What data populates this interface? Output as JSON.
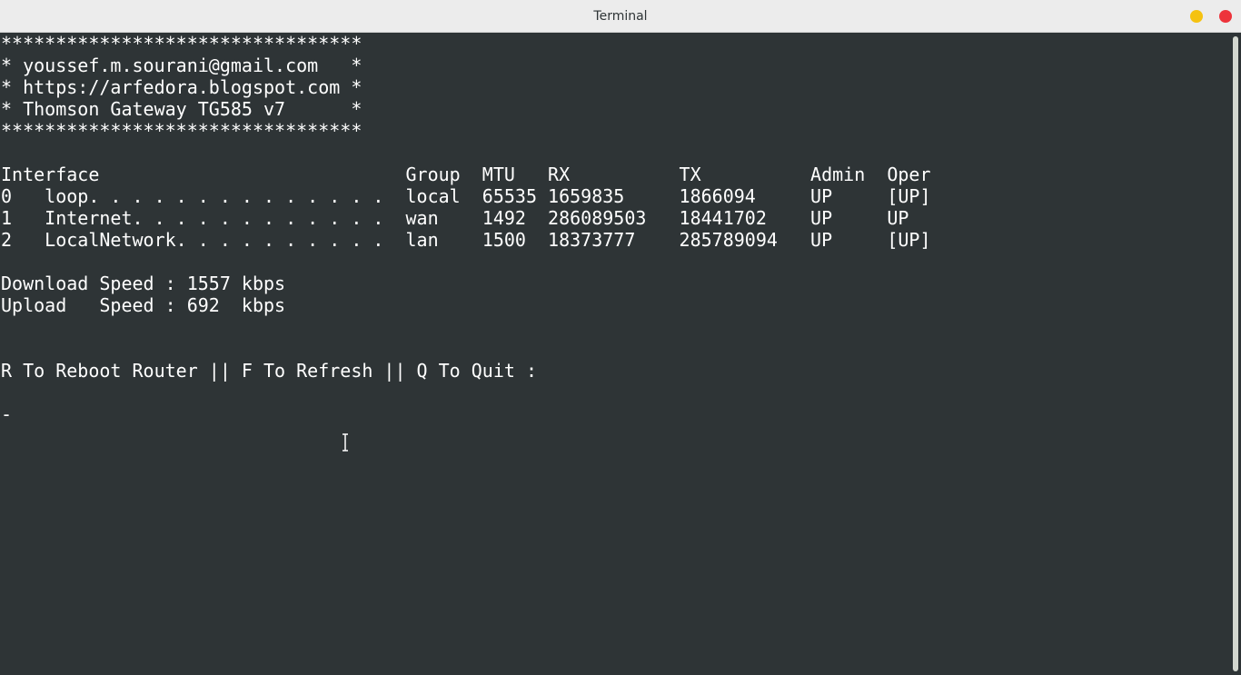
{
  "window": {
    "title": "Terminal"
  },
  "terminal": {
    "lines": [
      "*********************************",
      "* youssef.m.sourani@gmail.com   *",
      "* https://arfedora.blogspot.com *",
      "* Thomson Gateway TG585 v7      *",
      "*********************************",
      "",
      "Interface                            Group  MTU   RX          TX          Admin  Oper",
      "0   loop. . . . . . . . . . . . . .  local  65535 1659835     1866094     UP     [UP]",
      "1   Internet. . . . . . . . . . . .  wan    1492  286089503   18441702    UP     UP",
      "2   LocalNetwork. . . . . . . . . .  lan    1500  18373777    285789094   UP     [UP]",
      "",
      "Download Speed : 1557 kbps",
      "Upload   Speed : 692  kbps",
      "",
      "",
      "R To Reboot Router || F To Refresh || Q To Quit :",
      "",
      "-"
    ]
  },
  "colors": {
    "background": "#2e3436",
    "foreground": "#ffffff",
    "titlebar": "#ececec",
    "minimize": "#f5c211",
    "close": "#ed333b"
  }
}
